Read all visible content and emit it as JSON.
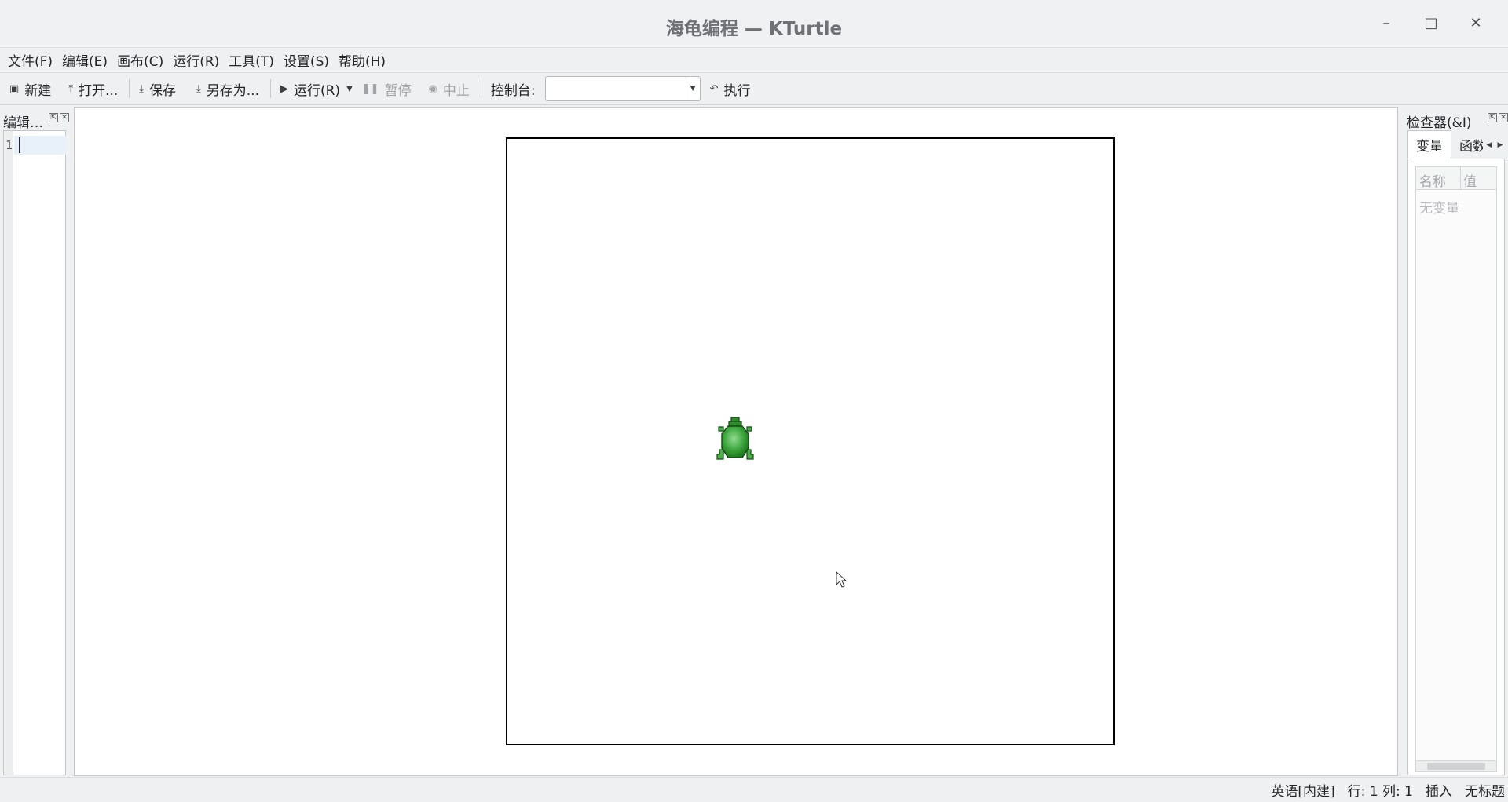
{
  "window": {
    "title": "海龟编程 — KTurtle",
    "minimize_glyph": "–",
    "maximize_glyph": "□",
    "close_glyph": "✕"
  },
  "menu": [
    {
      "label": "文件(F)"
    },
    {
      "label": "编辑(E)"
    },
    {
      "label": "画布(C)"
    },
    {
      "label": "运行(R)"
    },
    {
      "label": "工具(T)"
    },
    {
      "label": "设置(S)"
    },
    {
      "label": "帮助(H)"
    }
  ],
  "toolbar": {
    "new_label": "新建",
    "open_label": "打开...",
    "save_label": "保存",
    "save_as_label": "另存为...",
    "run_label": "运行(R)",
    "pause_label": "暂停",
    "abort_label": "中止",
    "console_label": "控制台:",
    "console_value": "",
    "execute_label": "执行"
  },
  "editor_dock": {
    "title": "编辑…",
    "line_number": "1",
    "code": ""
  },
  "inspector_dock": {
    "title": "检查器(&I)",
    "tabs": [
      {
        "label": "变量",
        "active": true
      },
      {
        "label": "函数",
        "active": false
      }
    ],
    "columns": [
      "名称",
      "值"
    ],
    "empty_text": "无变量"
  },
  "statusbar": {
    "language": "英语[内建]",
    "position": "行: 1 列: 1",
    "mode": "插入",
    "filename": "无标题"
  },
  "colors": {
    "accent": "#3daee9",
    "turtle_dark": "#1e6e1e",
    "turtle_light": "#5bbf5b",
    "disabled_text": "#a0a3a6"
  }
}
